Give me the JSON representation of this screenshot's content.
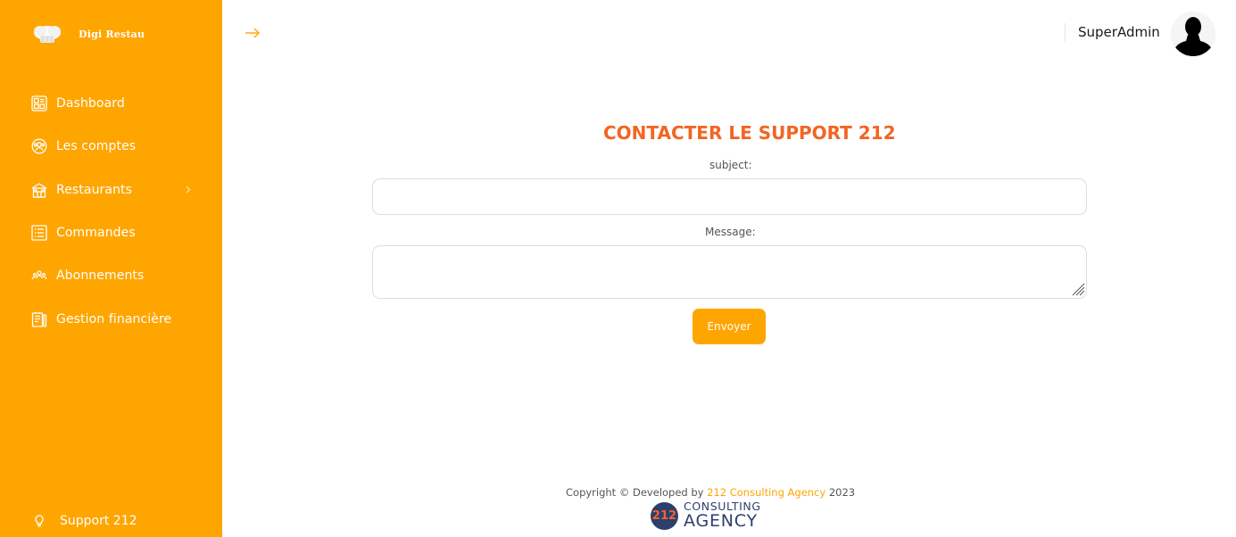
{
  "app": {
    "brand_name": "Digi Restau",
    "accent_color": "#ffa500",
    "title_color": "#f26522"
  },
  "sidebar": {
    "items": [
      {
        "label": "Dashboard",
        "icon": "dashboard-icon"
      },
      {
        "label": "Les comptes",
        "icon": "accounts-icon"
      },
      {
        "label": "Restaurants",
        "icon": "restaurant-icon",
        "has_submenu": true
      },
      {
        "label": "Commandes",
        "icon": "orders-icon"
      },
      {
        "label": "Abonnements",
        "icon": "subscriptions-icon"
      },
      {
        "label": "Gestion financière",
        "icon": "finance-icon"
      }
    ],
    "support_label": "Support 212"
  },
  "header": {
    "user_name": "SuperAdmin"
  },
  "form": {
    "title": "CONTACTER LE SUPPORT 212",
    "subject_label": "subject:",
    "subject_value": "",
    "message_label": "Message:",
    "message_value": "",
    "submit_label": "Envoyer"
  },
  "footer": {
    "copyright_prefix": "Copyright © Developed by ",
    "company_link": "212 Consulting Agency",
    "year": " 2023",
    "logo_number": "212",
    "logo_line1": "CONSULTING",
    "logo_line2": "AGENCY"
  }
}
